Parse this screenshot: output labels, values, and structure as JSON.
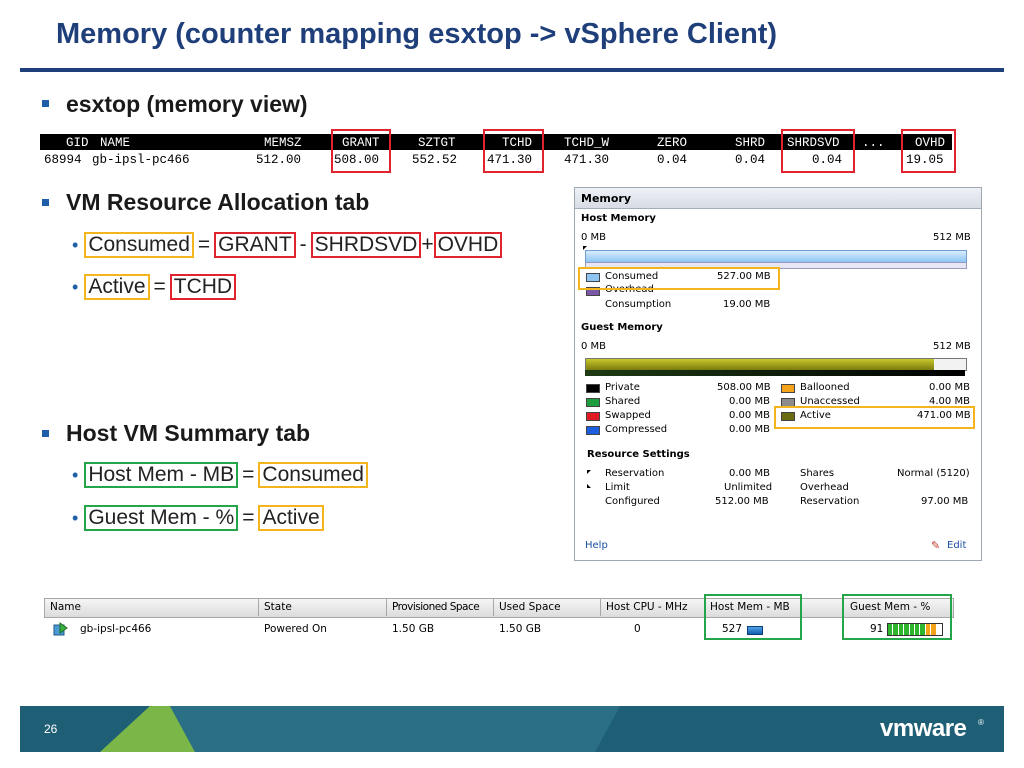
{
  "slide": {
    "title": "Memory (counter mapping esxtop -> vSphere Client)",
    "page_number": "26",
    "logo_text": "vmware"
  },
  "bullets": {
    "esxtop": "esxtop (memory view)",
    "resource_tab": "VM Resource Allocation tab",
    "summary_tab": "Host VM Summary tab"
  },
  "mappings": {
    "consumed": {
      "lhs": "Consumed",
      "a": "GRANT",
      "b": "SHRDSVD",
      "c": "OVHD",
      "op1": "=",
      "op2": "-",
      "op3": "+"
    },
    "active": {
      "lhs": "Active",
      "rhs": "TCHD",
      "op": "="
    },
    "host_mem": {
      "lhs": "Host Mem - MB",
      "rhs": "Consumed",
      "op": "="
    },
    "guest_mem": {
      "lhs": "Guest Mem - %",
      "rhs": "Active",
      "op": "="
    }
  },
  "esxtop_table": {
    "headers": [
      "GID",
      "NAME",
      "MEMSZ",
      "GRANT",
      "SZTGT",
      "TCHD",
      "TCHD_W",
      "ZERO",
      "SHRD",
      "SHRDSVD",
      "OVHD"
    ],
    "ellipsis": "...",
    "row": [
      "68994",
      "gb-ipsl-pc466",
      "512.00",
      "508.00",
      "552.52",
      "471.30",
      "471.30",
      "0.04",
      "0.04",
      "0.04",
      "19.05"
    ]
  },
  "memory_panel": {
    "title": "Memory",
    "host_memory": {
      "heading": "Host Memory",
      "min_label": "0 MB",
      "max_label": "512 MB",
      "consumed_label": "Consumed",
      "consumed_value": "527.00 MB",
      "overhead_label": "Overhead",
      "consumption_label": "Consumption",
      "consumption_value": "19.00 MB"
    },
    "guest_memory": {
      "heading": "Guest Memory",
      "min_label": "0 MB",
      "max_label": "512 MB",
      "left_items": [
        {
          "label": "Private",
          "value": "508.00 MB",
          "color": "#000000"
        },
        {
          "label": "Shared",
          "value": "0.00 MB",
          "color": "#1e9e3e"
        },
        {
          "label": "Swapped",
          "value": "0.00 MB",
          "color": "#e01b24"
        },
        {
          "label": "Compressed",
          "value": "0.00 MB",
          "color": "#1b5fe0"
        }
      ],
      "right_items": [
        {
          "label": "Ballooned",
          "value": "0.00 MB",
          "color": "#f5a31a"
        },
        {
          "label": "Unaccessed",
          "value": "4.00 MB",
          "color": "#8c8c8c"
        },
        {
          "label": "Active",
          "value": "471.00 MB",
          "color": "#6b6b12"
        }
      ]
    },
    "resource_settings": {
      "heading": "Resource Settings",
      "left": [
        {
          "label": "Reservation",
          "value": "0.00 MB"
        },
        {
          "label": "Limit",
          "value": "Unlimited"
        },
        {
          "label": "Configured",
          "value": "512.00 MB"
        }
      ],
      "right": [
        {
          "label": "Shares",
          "value": "Normal (5120)"
        },
        {
          "label": "Overhead",
          "value": ""
        },
        {
          "label": "Reservation",
          "value": "97.00 MB"
        }
      ]
    },
    "help_label": "Help",
    "edit_label": "Edit"
  },
  "summary_table": {
    "headers": [
      "Name",
      "State",
      "Provisioned Space",
      "Used Space",
      "Host CPU - MHz",
      "Host Mem - MB",
      "Guest Mem - %"
    ],
    "row": {
      "name": "gb-ipsl-pc466",
      "state": "Powered On",
      "provisioned": "1.50 GB",
      "used": "1.50 GB",
      "cpu": "0",
      "host_mem": "527",
      "guest_mem": "91"
    }
  },
  "colors": {
    "title_blue": "#1f3f7a",
    "highlight_orange": "#f3b51b",
    "highlight_red": "#e0232f",
    "highlight_green": "#25a54a",
    "footer_teal": "#1f5f76",
    "footer_green": "#7ab648"
  }
}
